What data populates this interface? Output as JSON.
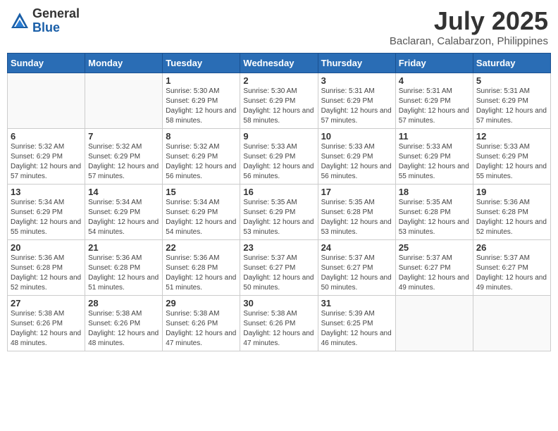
{
  "logo": {
    "general": "General",
    "blue": "Blue"
  },
  "title": {
    "month_year": "July 2025",
    "location": "Baclaran, Calabarzon, Philippines"
  },
  "headers": [
    "Sunday",
    "Monday",
    "Tuesday",
    "Wednesday",
    "Thursday",
    "Friday",
    "Saturday"
  ],
  "weeks": [
    [
      {
        "day": "",
        "info": ""
      },
      {
        "day": "",
        "info": ""
      },
      {
        "day": "1",
        "info": "Sunrise: 5:30 AM\nSunset: 6:29 PM\nDaylight: 12 hours and 58 minutes."
      },
      {
        "day": "2",
        "info": "Sunrise: 5:30 AM\nSunset: 6:29 PM\nDaylight: 12 hours and 58 minutes."
      },
      {
        "day": "3",
        "info": "Sunrise: 5:31 AM\nSunset: 6:29 PM\nDaylight: 12 hours and 57 minutes."
      },
      {
        "day": "4",
        "info": "Sunrise: 5:31 AM\nSunset: 6:29 PM\nDaylight: 12 hours and 57 minutes."
      },
      {
        "day": "5",
        "info": "Sunrise: 5:31 AM\nSunset: 6:29 PM\nDaylight: 12 hours and 57 minutes."
      }
    ],
    [
      {
        "day": "6",
        "info": "Sunrise: 5:32 AM\nSunset: 6:29 PM\nDaylight: 12 hours and 57 minutes."
      },
      {
        "day": "7",
        "info": "Sunrise: 5:32 AM\nSunset: 6:29 PM\nDaylight: 12 hours and 57 minutes."
      },
      {
        "day": "8",
        "info": "Sunrise: 5:32 AM\nSunset: 6:29 PM\nDaylight: 12 hours and 56 minutes."
      },
      {
        "day": "9",
        "info": "Sunrise: 5:33 AM\nSunset: 6:29 PM\nDaylight: 12 hours and 56 minutes."
      },
      {
        "day": "10",
        "info": "Sunrise: 5:33 AM\nSunset: 6:29 PM\nDaylight: 12 hours and 56 minutes."
      },
      {
        "day": "11",
        "info": "Sunrise: 5:33 AM\nSunset: 6:29 PM\nDaylight: 12 hours and 55 minutes."
      },
      {
        "day": "12",
        "info": "Sunrise: 5:33 AM\nSunset: 6:29 PM\nDaylight: 12 hours and 55 minutes."
      }
    ],
    [
      {
        "day": "13",
        "info": "Sunrise: 5:34 AM\nSunset: 6:29 PM\nDaylight: 12 hours and 55 minutes."
      },
      {
        "day": "14",
        "info": "Sunrise: 5:34 AM\nSunset: 6:29 PM\nDaylight: 12 hours and 54 minutes."
      },
      {
        "day": "15",
        "info": "Sunrise: 5:34 AM\nSunset: 6:29 PM\nDaylight: 12 hours and 54 minutes."
      },
      {
        "day": "16",
        "info": "Sunrise: 5:35 AM\nSunset: 6:29 PM\nDaylight: 12 hours and 53 minutes."
      },
      {
        "day": "17",
        "info": "Sunrise: 5:35 AM\nSunset: 6:28 PM\nDaylight: 12 hours and 53 minutes."
      },
      {
        "day": "18",
        "info": "Sunrise: 5:35 AM\nSunset: 6:28 PM\nDaylight: 12 hours and 53 minutes."
      },
      {
        "day": "19",
        "info": "Sunrise: 5:36 AM\nSunset: 6:28 PM\nDaylight: 12 hours and 52 minutes."
      }
    ],
    [
      {
        "day": "20",
        "info": "Sunrise: 5:36 AM\nSunset: 6:28 PM\nDaylight: 12 hours and 52 minutes."
      },
      {
        "day": "21",
        "info": "Sunrise: 5:36 AM\nSunset: 6:28 PM\nDaylight: 12 hours and 51 minutes."
      },
      {
        "day": "22",
        "info": "Sunrise: 5:36 AM\nSunset: 6:28 PM\nDaylight: 12 hours and 51 minutes."
      },
      {
        "day": "23",
        "info": "Sunrise: 5:37 AM\nSunset: 6:27 PM\nDaylight: 12 hours and 50 minutes."
      },
      {
        "day": "24",
        "info": "Sunrise: 5:37 AM\nSunset: 6:27 PM\nDaylight: 12 hours and 50 minutes."
      },
      {
        "day": "25",
        "info": "Sunrise: 5:37 AM\nSunset: 6:27 PM\nDaylight: 12 hours and 49 minutes."
      },
      {
        "day": "26",
        "info": "Sunrise: 5:37 AM\nSunset: 6:27 PM\nDaylight: 12 hours and 49 minutes."
      }
    ],
    [
      {
        "day": "27",
        "info": "Sunrise: 5:38 AM\nSunset: 6:26 PM\nDaylight: 12 hours and 48 minutes."
      },
      {
        "day": "28",
        "info": "Sunrise: 5:38 AM\nSunset: 6:26 PM\nDaylight: 12 hours and 48 minutes."
      },
      {
        "day": "29",
        "info": "Sunrise: 5:38 AM\nSunset: 6:26 PM\nDaylight: 12 hours and 47 minutes."
      },
      {
        "day": "30",
        "info": "Sunrise: 5:38 AM\nSunset: 6:26 PM\nDaylight: 12 hours and 47 minutes."
      },
      {
        "day": "31",
        "info": "Sunrise: 5:39 AM\nSunset: 6:25 PM\nDaylight: 12 hours and 46 minutes."
      },
      {
        "day": "",
        "info": ""
      },
      {
        "day": "",
        "info": ""
      }
    ]
  ]
}
